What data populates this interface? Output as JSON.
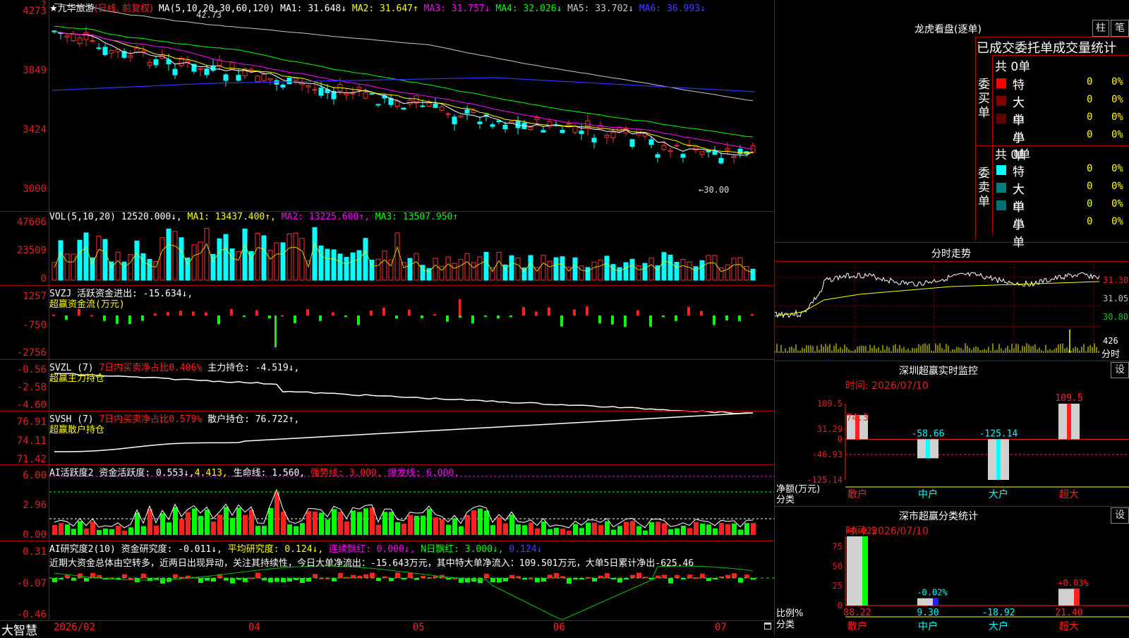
{
  "main": {
    "title_star": "★",
    "stock_name": "九华旅游",
    "period": "(日线, 前复权)",
    "ma_header": "MA(5,10,20,30,60,120)",
    "ma_values": [
      {
        "label": "MA1:",
        "value": "31.648",
        "arrow": "↓",
        "color": "#ffffff"
      },
      {
        "label": "MA2:",
        "value": "31.647",
        "arrow": "↑",
        "color": "#ffff00"
      },
      {
        "label": "MA3:",
        "value": "31.757",
        "arrow": "↓",
        "color": "#ff00ff"
      },
      {
        "label": "MA4:",
        "value": "32.026",
        "arrow": "↓",
        "color": "#00ff00"
      },
      {
        "label": "MA5:",
        "value": "33.702",
        "arrow": "↓",
        "color": "#c8c8c8"
      },
      {
        "label": "MA6:",
        "value": "36.993",
        "arrow": "↓",
        "color": "#4040ff"
      }
    ],
    "y_labels": [
      "4273",
      "3849",
      "3424",
      "3000"
    ],
    "top_left_mark": "?",
    "high_mark": "42.73",
    "low_mark": "←30.00"
  },
  "vol": {
    "header": "VOL(5,10,20)",
    "value": "12520.000↓,",
    "ma1": "MA1: 13437.400↑,",
    "ma2": "MA2: 13225.600↑,",
    "ma3": "MA3: 13507.950↑",
    "y_labels": [
      "47606",
      "23509",
      "0"
    ]
  },
  "svzj": {
    "header": "SVZJ  活跃资金进出: -15.634↓,",
    "sub": "超赢资金流(万元)",
    "y_labels": [
      "1257",
      "-750",
      "-2756"
    ]
  },
  "svzl": {
    "header_a": "SVZL (7)",
    "header_b": "7日内买卖净占比0.406%",
    "header_c": "主力持仓: -4.519↓,",
    "sub": "超赢主力持仓",
    "y_labels": [
      "-0.56",
      "-2.58",
      "-4.60"
    ]
  },
  "svsh": {
    "header_a": "SVSH (7)",
    "header_b": "7日内买卖净占比0.579%",
    "header_c": "散户持仓: 76.722↑,",
    "sub": "超赢散户持仓",
    "y_labels": [
      "76.91",
      "74.11",
      "71.42"
    ]
  },
  "ai1": {
    "name": "AI活跃度2",
    "a": "资金活跃度: 0.553↓,",
    "b": "4.413,",
    "c": "生命线: 1.560,",
    "d": "强势线: 3.000,",
    "e": "爆发线: 6.000,",
    "y_labels": [
      "6.00",
      "2.96",
      "0.00"
    ]
  },
  "ai2": {
    "name": "AI研究度2(10)",
    "a": "资金研究度: -0.011↓,",
    "b": "平均研究度: 0.124↓,",
    "c": "连续飘红: 0.000↓,",
    "d": "N日飘红: 3.000↓,",
    "e": "0.124↓",
    "y_labels": [
      "0.31",
      "-0.07",
      "-0.46"
    ],
    "summary": "近期大资金总体由空转多，近两日出现异动，关注其持续性，今日大单净流出：-15.643万元，其中特大单净流入：109.501万元，大单5日累计净出-625.46"
  },
  "bottom_bar": {
    "brand": "大智慧",
    "dates": [
      "2026/02",
      "04",
      "05",
      "06",
      "07"
    ]
  },
  "lhb": {
    "title": "龙虎看盘(逐单)",
    "btn1": "柱",
    "btn2": "笔",
    "subtitle": "已成交委托单成交量统计",
    "buy_side": "委买单",
    "sell_side": "委卖单",
    "buy_total": "共 0单",
    "sell_total": "共 0单",
    "buy_rows": [
      {
        "label": "特大",
        "count": "0",
        "pct": "0%",
        "color": "#ff0000"
      },
      {
        "label": "大单",
        "count": "0",
        "pct": "0%",
        "color": "#800000"
      },
      {
        "label": "中单",
        "count": "0",
        "pct": "0%",
        "color": "#600000"
      },
      {
        "label": "小单",
        "count": "0",
        "pct": "0%",
        "color": ""
      }
    ],
    "sell_rows": [
      {
        "label": "特大",
        "count": "0",
        "pct": "0%",
        "color": "#00ffff"
      },
      {
        "label": "大单",
        "count": "0",
        "pct": "0%",
        "color": "#008080"
      },
      {
        "label": "中单",
        "count": "0",
        "pct": "0%",
        "color": "#007070"
      },
      {
        "label": "小单",
        "count": "0",
        "pct": "0%",
        "color": ""
      }
    ]
  },
  "intraday": {
    "title": "分时走势",
    "y_labels": [
      "31.30",
      "31.05",
      "30.80"
    ],
    "vol_label": "426",
    "unit": "分时"
  },
  "sz_monitor": {
    "title": "深圳超赢实时监控",
    "btn": "设",
    "time": "时间: 2026/07/10",
    "y_labels": [
      "109.5",
      "31.29",
      "0",
      "-46.93",
      "-125.14"
    ],
    "unit1": "净额(万元)",
    "unit2": "分类",
    "cats": [
      "散户",
      "中户",
      "大户",
      "超大"
    ],
    "values": [
      74.3,
      -58.66,
      -125.14,
      109.5
    ],
    "value_labels": [
      "74.3",
      "-58.66",
      "-125.14",
      "109.5"
    ]
  },
  "sz_class": {
    "title": "深市超赢分类统计",
    "btn": "设",
    "time": "时间: 2026/07/10",
    "y_labels": [
      "75",
      "50",
      "25",
      "0"
    ],
    "unit1": "比例%",
    "unit2": "分类",
    "cats": [
      "散户",
      "中户",
      "大户",
      "超大"
    ],
    "values": [
      88.22,
      9.3,
      -18.92,
      21.4
    ],
    "value_labels": [
      "88.22",
      "9.30",
      "-18.92",
      "21.40"
    ],
    "change_labels": [
      "+0.02%",
      "-0.02%",
      "",
      "+0.03%"
    ]
  }
}
